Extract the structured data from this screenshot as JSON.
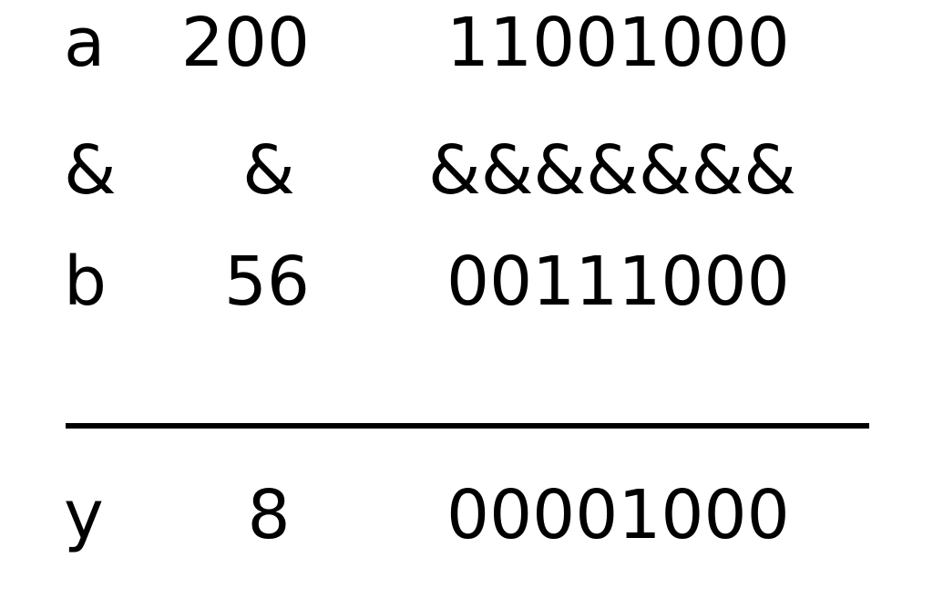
{
  "rows": [
    {
      "var": "a",
      "dec": "200",
      "bin": "11001000"
    },
    {
      "var": "&",
      "dec": "&",
      "bin": "&&&&&&&"
    },
    {
      "var": "b",
      "dec": "56",
      "bin": "00111000"
    },
    {
      "var": "y",
      "dec": "8",
      "bin": "00001000"
    }
  ],
  "divider": "____________________"
}
